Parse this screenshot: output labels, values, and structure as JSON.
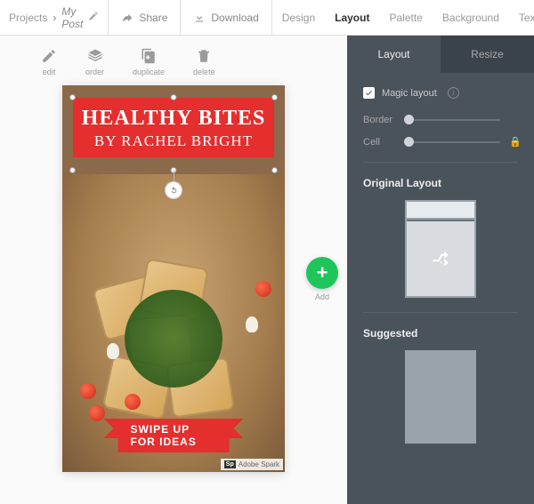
{
  "breadcrumb": {
    "root": "Projects",
    "current": "My Post"
  },
  "topbar": {
    "share": "Share",
    "download": "Download",
    "tabs": [
      "Design",
      "Layout",
      "Palette",
      "Background",
      "Text"
    ],
    "active_tab": "Layout"
  },
  "tools": {
    "edit": "edit",
    "order": "order",
    "duplicate": "duplicate",
    "delete": "delete"
  },
  "canvas": {
    "title": "HEALTHY BITES",
    "subtitle": "BY RACHEL BRIGHT",
    "ribbon": "SWIPE UP FOR IDEAS",
    "watermark_brand": "Adobe Spark",
    "watermark_badge": "Sp"
  },
  "add_button": {
    "label": "Add"
  },
  "panel": {
    "tabs": {
      "layout": "Layout",
      "resize": "Resize",
      "active": "Layout"
    },
    "magic_layout": "Magic layout",
    "sliders": {
      "border": "Border",
      "cell": "Cell"
    },
    "original_layout": "Original Layout",
    "suggested": "Suggested"
  },
  "colors": {
    "accent_red": "#e52e2e",
    "add_green": "#1ec659",
    "panel_bg": "#4a525a"
  }
}
